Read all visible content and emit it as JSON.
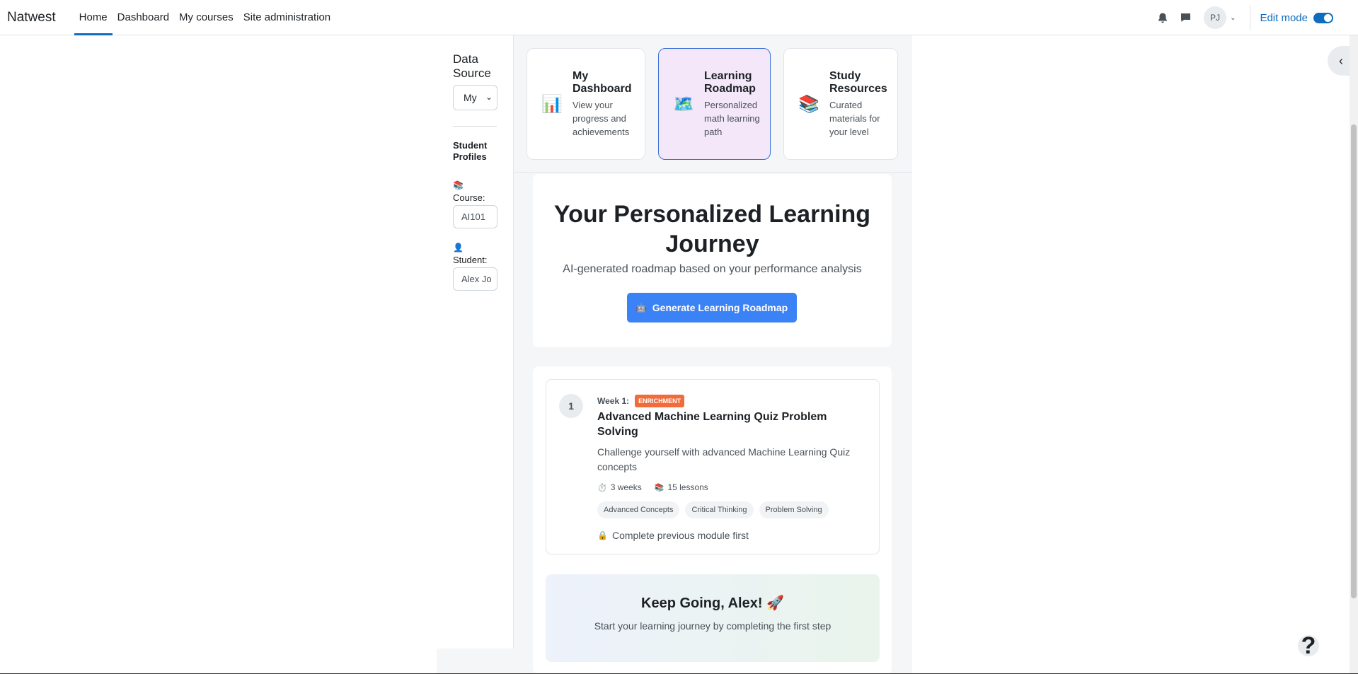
{
  "navbar": {
    "brand": "Natwest",
    "items": [
      {
        "label": "Home",
        "active": true
      },
      {
        "label": "Dashboard",
        "active": false
      },
      {
        "label": "My courses",
        "active": false
      },
      {
        "label": "Site administration",
        "active": false
      }
    ],
    "avatar_initials": "PJ",
    "edit_mode_label": "Edit mode",
    "edit_mode_on": true
  },
  "sidebar": {
    "title": "Data Source",
    "source_select_value": "My",
    "profiles_heading": "Student Profiles",
    "course_label": "Course:",
    "course_value": "AI101",
    "student_label": "Student:",
    "student_value": "Alex Jo"
  },
  "cards": [
    {
      "icon": "📊",
      "icon_name": "bar-chart-icon",
      "title": "My Dashboard",
      "desc": "View your progress and achievements",
      "active": false
    },
    {
      "icon": "🗺️",
      "icon_name": "map-icon",
      "title": "Learning Roadmap",
      "desc": "Personalized math learning path",
      "active": true
    },
    {
      "icon": "📚",
      "icon_name": "books-icon",
      "title": "Study Resources",
      "desc": "Curated materials for your level",
      "active": false
    }
  ],
  "hero": {
    "title": "Your Personalized Learning Journey",
    "subtitle": "AI-generated roadmap based on your performance analysis",
    "button_label": "Generate Learning Roadmap"
  },
  "modules": [
    {
      "number": "1",
      "week": "Week 1:",
      "badge": "ENRICHMENT",
      "title": "Advanced Machine Learning Quiz Problem Solving",
      "description": "Challenge yourself with advanced Machine Learning Quiz concepts",
      "duration": "3 weeks",
      "lessons": "15 lessons",
      "tags": [
        "Advanced Concepts",
        "Critical Thinking",
        "Problem Solving"
      ],
      "lock_text": "Complete previous module first"
    }
  ],
  "motivation": {
    "title": "Keep Going, Alex! 🚀",
    "subtitle": "Start your learning journey by completing the first step"
  },
  "colors": {
    "accent": "#0f6cbf",
    "button_blue": "#3b82f6",
    "badge_orange": "#f26b3a",
    "active_card_bg": "#f3e7f9"
  }
}
